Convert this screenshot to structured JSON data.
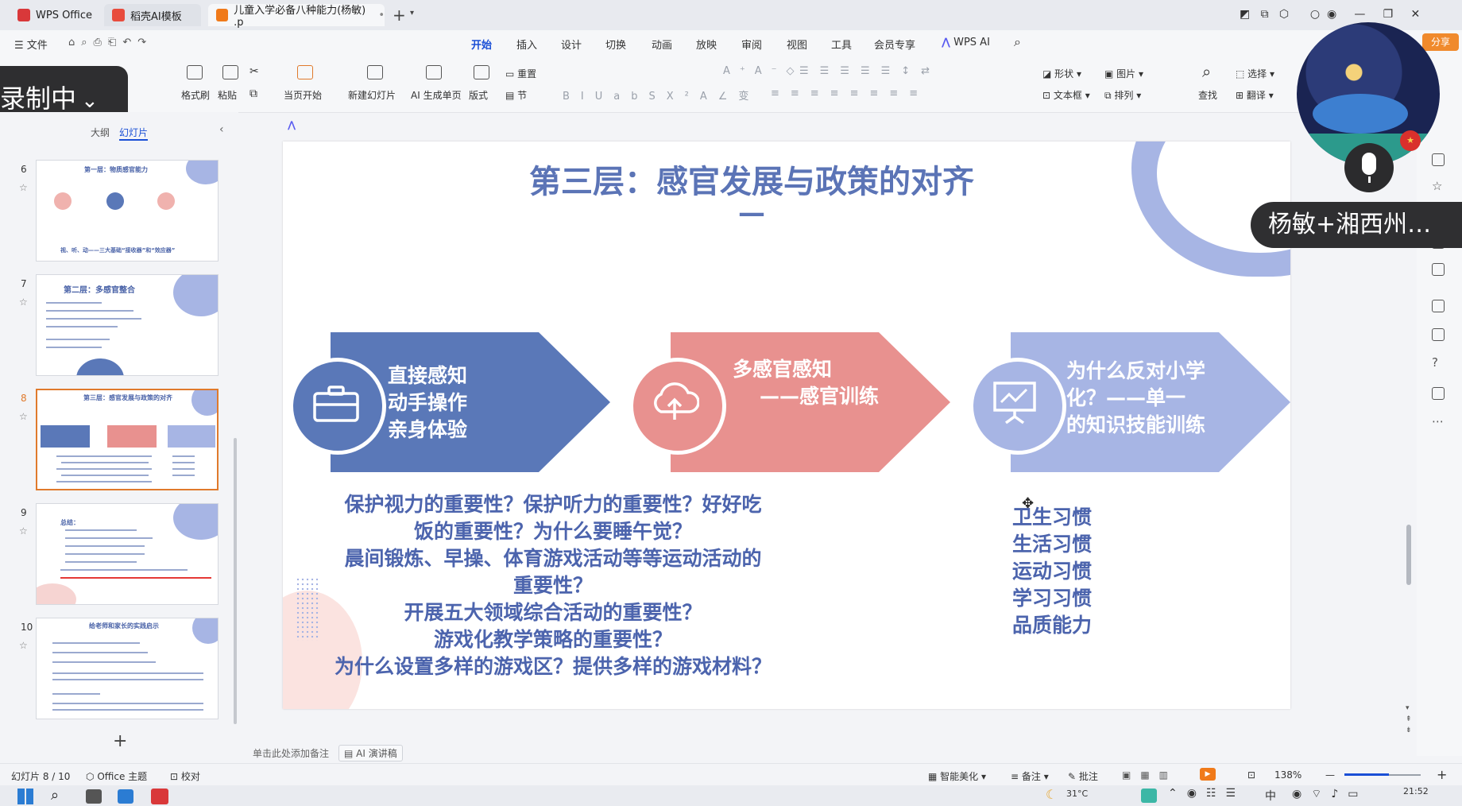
{
  "tabs": [
    {
      "label": "WPS Office",
      "color": "#d9383a"
    },
    {
      "label": "稻壳AI模板",
      "color": "#e84c3d"
    },
    {
      "label": "儿童入学必备八种能力(杨敏) .p",
      "color": "#f07a1a"
    }
  ],
  "menu": {
    "file": "文件",
    "items": [
      "开始",
      "插入",
      "设计",
      "切换",
      "动画",
      "放映",
      "审阅",
      "视图",
      "工具",
      "会员专享",
      "WPS AI"
    ],
    "share": "分享"
  },
  "ribbon": {
    "format_painter": "格式刷",
    "paste": "粘贴",
    "from_current": "当页开始",
    "new_slide": "新建幻灯片",
    "ai_gen": "AI 生成单页",
    "layout": "版式",
    "reset": "重置",
    "section": "节",
    "shape": "形状",
    "picture": "图片",
    "textbox": "文本框",
    "arrange": "排列",
    "find": "查找",
    "select": "选择",
    "translate": "翻译"
  },
  "recording": "录制中",
  "video_caption": "杨敏+湘西州…",
  "left_panel": {
    "tab_outline": "大纲",
    "tab_slides": "幻灯片",
    "thumbs": [
      {
        "num": "6",
        "title": "第一层：物质感官能力",
        "footer": "视、听、动——三大基础“接收器”和“效应器”"
      },
      {
        "num": "7",
        "title": "第二层：多感官整合"
      },
      {
        "num": "8",
        "title": "第三层：感官发展与政策的对齐"
      },
      {
        "num": "9",
        "title": "总结："
      },
      {
        "num": "10",
        "title": "给老师和家长的实践启示"
      }
    ],
    "add": "+"
  },
  "slide": {
    "title": "第三层：感官发展与政策的对齐",
    "dash": "—",
    "box1": [
      "直接感知",
      "动手操作",
      "亲身体验"
    ],
    "box2": [
      "多感官感知",
      "——感官训练"
    ],
    "box3": [
      "为什么反对小学",
      "化？——单一",
      "的知识技能训练"
    ],
    "body_lines": [
      "保护视力的重要性？保护听力的重要性？好好吃",
      "饭的重要性？为什么要睡午觉？",
      "晨间锻炼、早操、体育游戏活动等等运动活动的",
      "重要性？",
      "开展五大领域综合活动的重要性？",
      "游戏化教学策略的重要性？",
      "为什么设置多样的游戏区？提供多样的游戏材料？"
    ],
    "habits": [
      "卫生习惯",
      "生活习惯",
      "运动习惯",
      "学习习惯",
      "品质能力"
    ],
    "colors": {
      "blue": "#5a78b8",
      "pink": "#e8918f",
      "light": "#a7b5e4",
      "title": "#5b74b6"
    }
  },
  "notes": {
    "placeholder": "单击此处添加备注",
    "ai_script": "AI 演讲稿"
  },
  "status": {
    "slide_pos": "幻灯片 8 / 10",
    "theme": "Office 主题",
    "proof": "校对",
    "beautify": "智能美化",
    "notes": "备注",
    "comment": "批注",
    "zoom": "138%"
  },
  "taskbar": {
    "temp": "31°C",
    "lang": "中",
    "time": "21:52"
  }
}
